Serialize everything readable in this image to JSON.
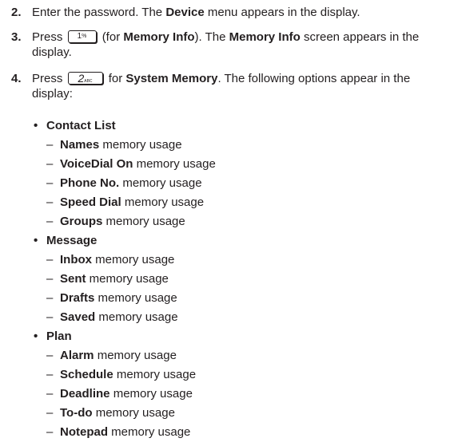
{
  "steps": [
    {
      "num": "2.",
      "pre": "Enter the password. The ",
      "bold1": "Device",
      "post": " menu appears in the display."
    },
    {
      "num": "3.",
      "word": "Press",
      "key_label": "1",
      "key_sub": "%",
      "pre": "(for ",
      "bold1": "Memory Info",
      "mid": "). The ",
      "bold2": "Memory Info",
      "post1": " screen appears in the",
      "post2": "display."
    },
    {
      "num": "4.",
      "word": "Press",
      "key_label": "2",
      "key_sub": "ABC",
      "pre": "for ",
      "bold1": "System Memory",
      "post1": ". The following options appear in the",
      "post2": "display:"
    }
  ],
  "bullet": "•",
  "dash": "–",
  "suffix": " memory usage",
  "categories": [
    {
      "title": "Contact List",
      "items": [
        "Names",
        "VoiceDial On",
        "Phone No.",
        "Speed Dial",
        "Groups"
      ]
    },
    {
      "title": "Message",
      "items": [
        "Inbox",
        "Sent",
        "Drafts",
        "Saved"
      ]
    },
    {
      "title": "Plan",
      "items": [
        "Alarm",
        "Schedule",
        "Deadline",
        "To-do",
        "Notepad"
      ]
    }
  ]
}
